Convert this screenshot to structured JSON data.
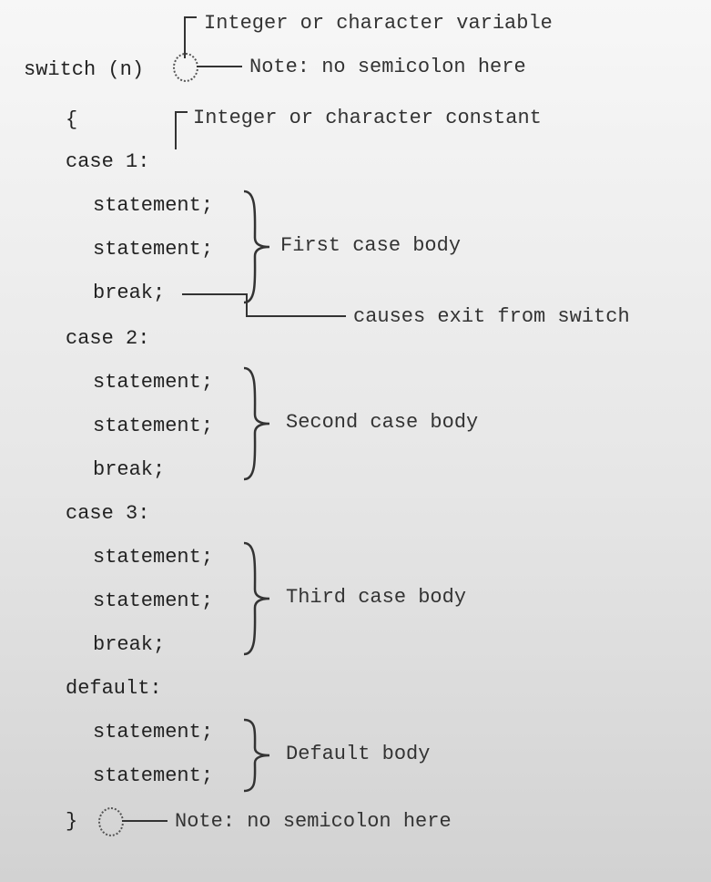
{
  "annotations": {
    "var_type": "Integer or character variable",
    "no_semicolon1": "Note: no semicolon here",
    "const_type": "Integer or character constant",
    "brace1": "First case body",
    "break_exit": "causes exit from switch",
    "brace2": "Second case body",
    "brace3": "Third case body",
    "brace4": "Default body",
    "no_semicolon2": "Note: no semicolon here"
  },
  "code": {
    "switch": "switch (n)",
    "open_brace": "{",
    "case1": "case 1:",
    "case2": "case 2:",
    "case3": "case 3:",
    "default": "default:",
    "stmt": "statement;",
    "break": "break;",
    "close_brace": "}"
  }
}
